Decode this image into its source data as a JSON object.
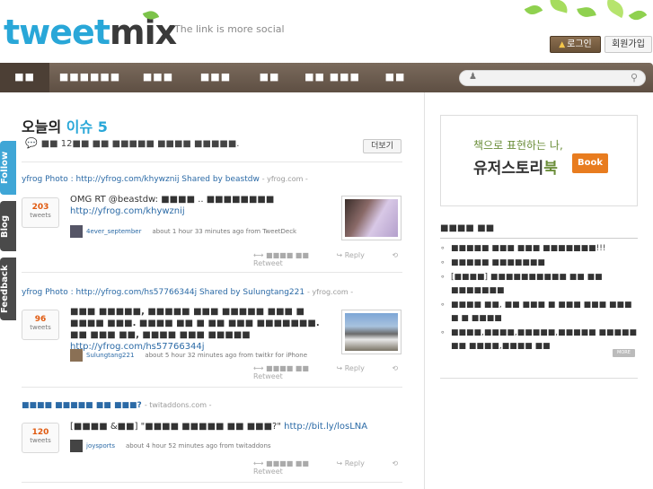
{
  "header": {
    "logo_part1": "tweet",
    "logo_part2": "mix",
    "tagline": "The link is more social",
    "login_label": "로그인",
    "join_label": "회원가입"
  },
  "nav": {
    "items": [
      "■■",
      "■■■■■■",
      "■■■",
      "■■■",
      "■■",
      "■■ ■■■",
      "■■"
    ],
    "search_placeholder": ""
  },
  "side_tabs": {
    "follow": "Follow",
    "blog": "Blog",
    "feedback": "Feedback"
  },
  "main": {
    "title_part1": "오늘의",
    "title_part2": "이슈 5",
    "subtitle": "■■  12■■ ■■ ■■■■■ ■■■■ ■■■■■.",
    "more_button": "더보기",
    "items": [
      {
        "headline": "yfrog Photo : http://yfrog.com/khywznij Shared by beastdw",
        "source": "- yfrog.com -",
        "count": "203",
        "count_label": "tweets",
        "text": "OMG RT @beastdw: ■■■■ .. ■■■■■■■■",
        "link": "http://yfrog.com/khywznij",
        "user": "4ever_september",
        "time": "about 1 hour 33 minutes ago from TweetDeck",
        "action_rt": "■■■■ ■■",
        "action_reply": "Reply",
        "action_retweet": "Retweet"
      },
      {
        "headline": "yfrog Photo : http://yfrog.com/hs57766344j Shared by Sulungtang221",
        "source": "- yfrog.com -",
        "count": "96",
        "count_label": "tweets",
        "text": "■■■ ■■■■■, ■■■■■ ■■■ ■■■■■ ■■■ ■ ■■■■ ■■■. ■■■■ ■■ ■ ■■ ■■■ ■■■■■■■. ■■ ■■■ ■■, ■■■■ ■■■ ■■■■■",
        "link": "http://yfrog.com/hs57766344j",
        "user": "Sulungtang221",
        "time": "about 5 hour 32 minutes ago from twitkr for iPhone",
        "action_rt": "■■■■ ■■",
        "action_reply": "Reply",
        "action_retweet": "Retweet"
      },
      {
        "headline": "■■■■ ■■■■■ ■■ ■■■?",
        "source": "- twitaddons.com -",
        "count": "120",
        "count_label": "tweets",
        "text": "[■■■■ &■■] \"■■■■ ■■■■■ ■■ ■■■?\"",
        "link": "http://bit.ly/losLNA",
        "user": "joysports",
        "time": "about 4 hour 52 minutes ago from twitaddons",
        "action_rt": "■■■■ ■■",
        "action_reply": "Reply",
        "action_retweet": "Retweet"
      }
    ]
  },
  "right": {
    "banner_line1": "책으로 표현하는 나,",
    "banner_line2a": "유저스토리",
    "banner_line2b": "북",
    "banner_badge": "Book",
    "list_title": "■■■■ ■■",
    "list": [
      "■■■■■ ■■■ ■■■ ■■■■■■■!!!",
      "■■■■■ ■■■■■■■",
      "[■■■■] ■■■■■■■■■■ ■■ ■■ ■■■■■■■",
      "■■■■ ■■, ■■ ■■■ ■ ■■■ ■■■ ■■■ ■ ■ ■■■■",
      "■■■■,■■■■,■■■■■,■■■■■ ■■■■■ ■■ ■■■■,■■■■ ■■"
    ],
    "more_tag": "MORE"
  },
  "colors": {
    "accent": "#29a7d8",
    "nav_bg": "#6b5b4e",
    "count": "#e05a10",
    "link": "#2b6aa6"
  }
}
